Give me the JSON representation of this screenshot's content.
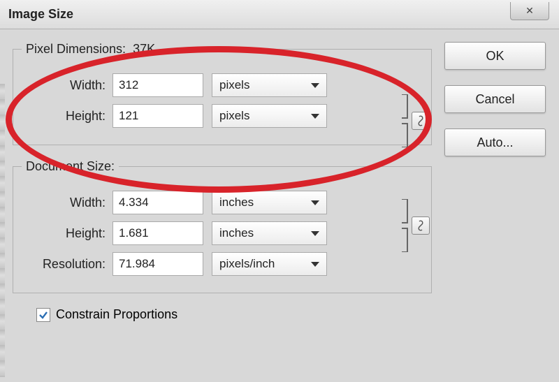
{
  "window": {
    "title": "Image Size"
  },
  "pixel_dimensions": {
    "legend": "Pixel Dimensions:",
    "size": "37K",
    "width_label": "Width:",
    "width_value": "312",
    "width_unit": "pixels",
    "height_label": "Height:",
    "height_value": "121",
    "height_unit": "pixels"
  },
  "document_size": {
    "legend": "Document Size:",
    "width_label": "Width:",
    "width_value": "4.334",
    "width_unit": "inches",
    "height_label": "Height:",
    "height_value": "1.681",
    "height_unit": "inches",
    "resolution_label": "Resolution:",
    "resolution_value": "71.984",
    "resolution_unit": "pixels/inch"
  },
  "constrain": {
    "label": "Constrain Proportions",
    "checked": true
  },
  "buttons": {
    "ok": "OK",
    "cancel": "Cancel",
    "auto": "Auto..."
  }
}
